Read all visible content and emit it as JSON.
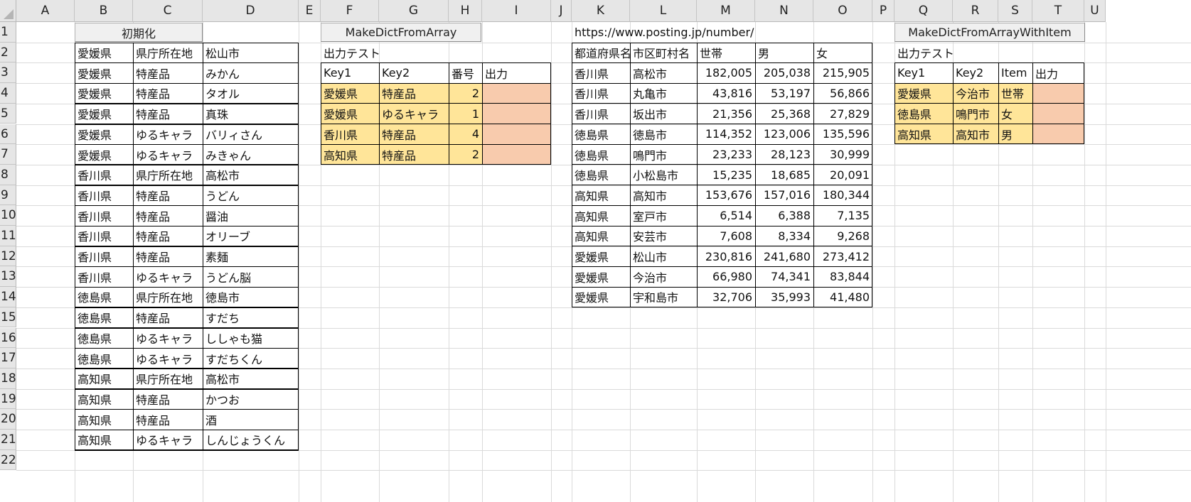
{
  "columns": [
    "A",
    "B",
    "C",
    "D",
    "E",
    "F",
    "G",
    "H",
    "I",
    "J",
    "K",
    "L",
    "M",
    "N",
    "O",
    "P",
    "Q",
    "R",
    "S",
    "T",
    "U"
  ],
  "rows": [
    "1",
    "2",
    "3",
    "4",
    "5",
    "6",
    "7",
    "8",
    "9",
    "10",
    "11",
    "12",
    "13",
    "14",
    "15",
    "16",
    "17",
    "18",
    "19",
    "20",
    "21",
    "22"
  ],
  "buttons": {
    "init": "初期化",
    "make_dict": "MakeDictFromArray",
    "make_dict_item": "MakeDictFromArrayWithItem"
  },
  "table_bd": [
    [
      "愛媛県",
      "県庁所在地",
      "松山市"
    ],
    [
      "愛媛県",
      "特産品",
      "みかん"
    ],
    [
      "愛媛県",
      "特産品",
      "タオル"
    ],
    [
      "愛媛県",
      "特産品",
      "真珠"
    ],
    [
      "愛媛県",
      "ゆるキャラ",
      "バリィさん"
    ],
    [
      "愛媛県",
      "ゆるキャラ",
      "みきゃん"
    ],
    [
      "香川県",
      "県庁所在地",
      "高松市"
    ],
    [
      "香川県",
      "特産品",
      "うどん"
    ],
    [
      "香川県",
      "特産品",
      "醤油"
    ],
    [
      "香川県",
      "特産品",
      "オリーブ"
    ],
    [
      "香川県",
      "特産品",
      "素麺"
    ],
    [
      "香川県",
      "ゆるキャラ",
      "うどん脳"
    ],
    [
      "徳島県",
      "県庁所在地",
      "徳島市"
    ],
    [
      "徳島県",
      "特産品",
      "すだち"
    ],
    [
      "徳島県",
      "ゆるキャラ",
      "ししゃも猫"
    ],
    [
      "徳島県",
      "ゆるキャラ",
      "すだちくん"
    ],
    [
      "高知県",
      "県庁所在地",
      "高松市"
    ],
    [
      "高知県",
      "特産品",
      "かつお"
    ],
    [
      "高知県",
      "特産品",
      "酒"
    ],
    [
      "高知県",
      "ゆるキャラ",
      "しんじょうくん"
    ]
  ],
  "test1": {
    "title": "出力テスト",
    "headers": [
      "Key1",
      "Key2",
      "番号",
      "出力"
    ],
    "rows": [
      [
        "愛媛県",
        "特産品",
        "2",
        ""
      ],
      [
        "愛媛県",
        "ゆるキャラ",
        "1",
        ""
      ],
      [
        "香川県",
        "特産品",
        "4",
        ""
      ],
      [
        "高知県",
        "特産品",
        "2",
        ""
      ]
    ]
  },
  "population": {
    "source_url": "https://www.posting.jp/number/",
    "headers": [
      "都道府県名",
      "市区町村名",
      "世帯",
      "男",
      "女"
    ],
    "rows": [
      [
        "香川県",
        "高松市",
        "182,005",
        "205,038",
        "215,905"
      ],
      [
        "香川県",
        "丸亀市",
        "43,816",
        "53,197",
        "56,866"
      ],
      [
        "香川県",
        "坂出市",
        "21,356",
        "25,368",
        "27,829"
      ],
      [
        "徳島県",
        "徳島市",
        "114,352",
        "123,006",
        "135,596"
      ],
      [
        "徳島県",
        "鳴門市",
        "23,233",
        "28,123",
        "30,999"
      ],
      [
        "徳島県",
        "小松島市",
        "15,235",
        "18,685",
        "20,091"
      ],
      [
        "高知県",
        "高知市",
        "153,676",
        "157,016",
        "180,344"
      ],
      [
        "高知県",
        "室戸市",
        "6,514",
        "6,388",
        "7,135"
      ],
      [
        "高知県",
        "安芸市",
        "7,608",
        "8,334",
        "9,268"
      ],
      [
        "愛媛県",
        "松山市",
        "230,816",
        "241,680",
        "273,412"
      ],
      [
        "愛媛県",
        "今治市",
        "66,980",
        "74,341",
        "83,844"
      ],
      [
        "愛媛県",
        "宇和島市",
        "32,706",
        "35,993",
        "41,480"
      ]
    ]
  },
  "test2": {
    "title": "出力テスト",
    "headers": [
      "Key1",
      "Key2",
      "Item",
      "出力"
    ],
    "rows": [
      [
        "愛媛県",
        "今治市",
        "世帯",
        ""
      ],
      [
        "徳島県",
        "鳴門市",
        "女",
        ""
      ],
      [
        "高知県",
        "高知市",
        "男",
        ""
      ]
    ]
  },
  "colors": {
    "input_fill": "#ffe599",
    "output_fill": "#f8cbad",
    "header_bg": "#e6e6e6",
    "gridline": "#dadada"
  }
}
